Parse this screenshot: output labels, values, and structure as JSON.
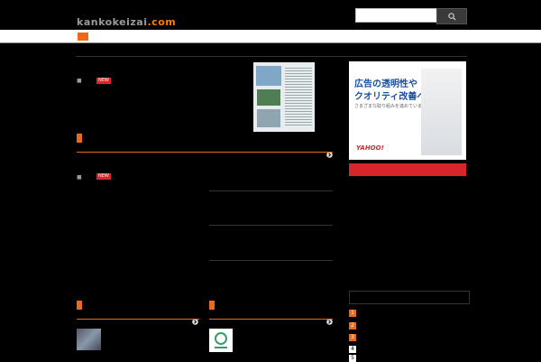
{
  "header": {
    "logo_title": "",
    "logo_domain": "kankokeizai",
    "logo_tld": ".com",
    "search_placeholder": "",
    "search_icon": "search-icon"
  },
  "ticker": {
    "badge": "",
    "text": ""
  },
  "subnav": {
    "text": ""
  },
  "featured": {
    "title": "",
    "comments": "",
    "date": "",
    "new_label": "NEW",
    "excerpt": "",
    "more": ""
  },
  "section1": {
    "tab": "",
    "more": ""
  },
  "article2": {
    "title": "",
    "comments": "",
    "date": "",
    "new_label": "NEW",
    "excerpt": "",
    "more": ""
  },
  "small_list": [
    {
      "title": "",
      "date": "",
      "views": ""
    },
    {
      "title": "",
      "date": "",
      "views": ""
    },
    {
      "title": "",
      "date": "",
      "views": ""
    },
    {
      "title": "",
      "date": "",
      "views": ""
    }
  ],
  "bottom_left": {
    "tab": "",
    "more": "",
    "item_title": "",
    "item_meta": ""
  },
  "bottom_mid": {
    "tab": "",
    "more": "",
    "item_title": "",
    "item_date": "",
    "item_meta": ""
  },
  "ad": {
    "line1": "広告の透明性や",
    "line2": "クオリティ改善への",
    "line3": "さまざまな取り組みを進めています。",
    "brand": "YAHOO!",
    "button": ""
  },
  "ranking": {
    "heading": "",
    "items": [
      {
        "num": "1",
        "text": ""
      },
      {
        "num": "2",
        "text": ""
      },
      {
        "num": "3",
        "text": ""
      },
      {
        "num": "4",
        "text": ""
      },
      {
        "num": "5",
        "text": ""
      }
    ]
  },
  "colors": {
    "accent": "#ea6a1c",
    "red": "#d7262b",
    "link": "#3d7be0",
    "background": "#000000"
  }
}
